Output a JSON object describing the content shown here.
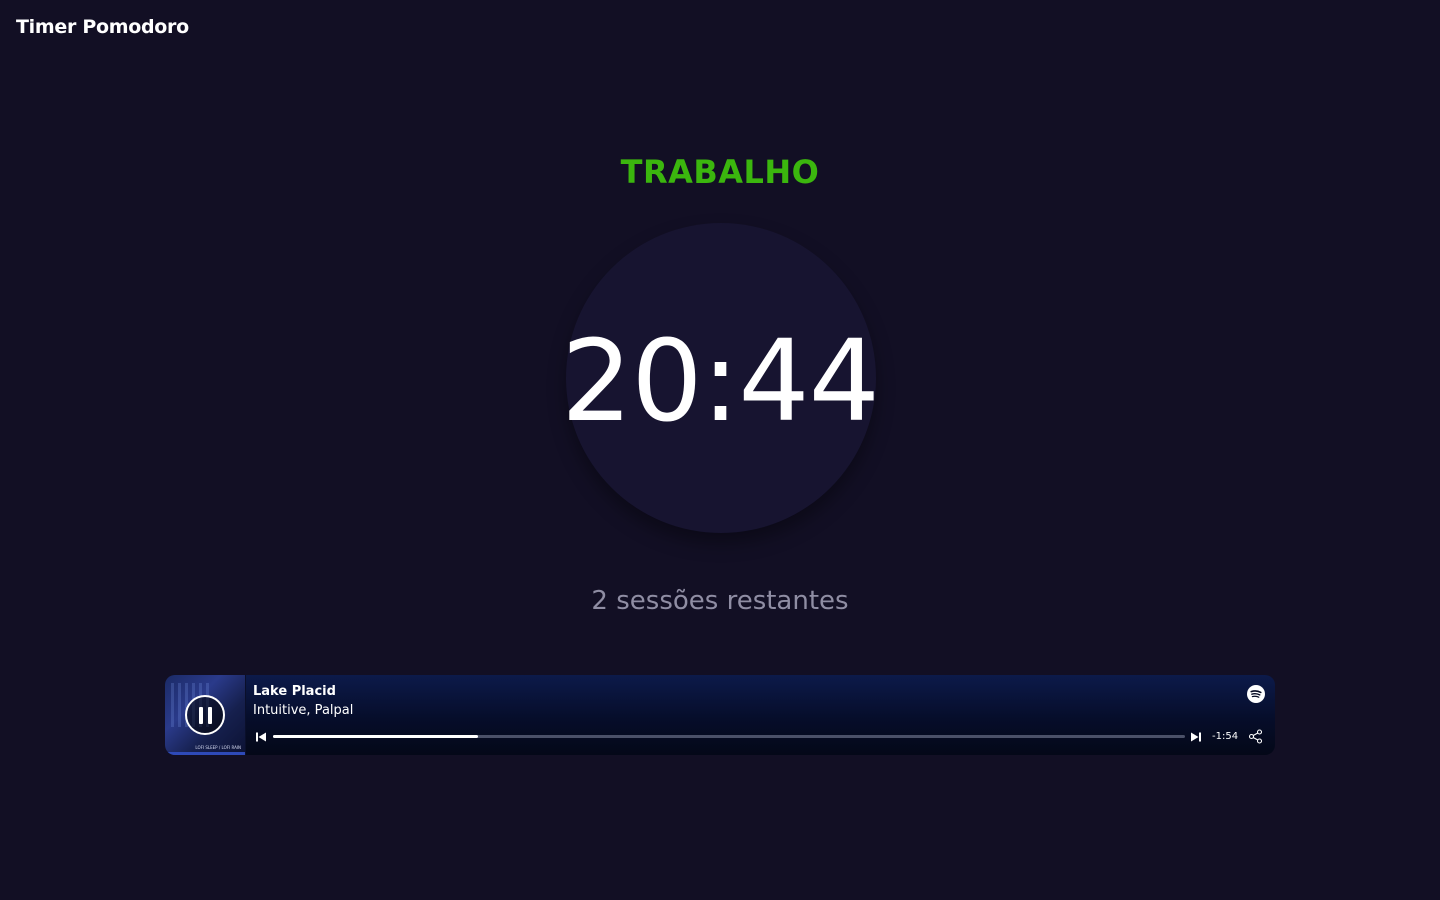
{
  "app": {
    "title": "Timer Pomodoro"
  },
  "timer": {
    "mode_label": "TRABALHO",
    "mode_color": "#3bb60e",
    "time": "20:44",
    "sessions_text": "2 sessões restantes"
  },
  "player": {
    "track_title": "Lake Placid",
    "artist": "Intuitive, Palpal",
    "time_remaining": "-1:54",
    "progress_fraction": 0.225,
    "cover_caption": "LOFI SLEEP / LOFI RAIN",
    "state": "playing",
    "icons": {
      "play_pause": "pause-icon",
      "brand": "spotify-icon",
      "previous": "skip-previous-icon",
      "next": "skip-next-icon",
      "share": "share-icon"
    }
  }
}
